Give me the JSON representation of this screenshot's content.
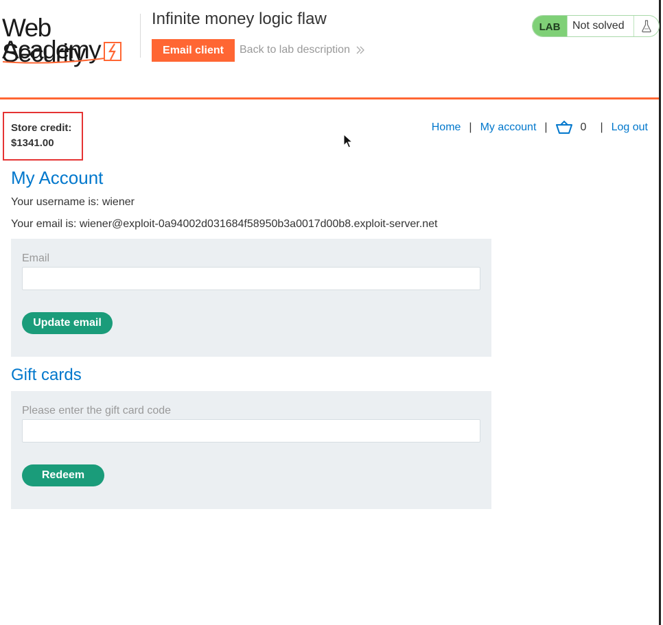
{
  "header": {
    "logo_line1": "Web Security",
    "logo_line2": "Academy",
    "lab_title": "Infinite money logic flaw",
    "email_client_label": "Email client",
    "back_link_label": "Back to lab description",
    "lab_badge": "LAB",
    "lab_status": "Not solved"
  },
  "store_credit": {
    "label": "Store credit:",
    "value": "$1341.00"
  },
  "nav": {
    "home": "Home",
    "my_account": "My account",
    "cart_count": "0",
    "log_out": "Log out",
    "separator": "|"
  },
  "account": {
    "title": "My Account",
    "username_line": "Your username is: wiener",
    "email_line": "Your email is: wiener@exploit-0a94002d031684f58950b3a0017d00b8.exploit-server.net",
    "email_field_label": "Email",
    "email_field_value": "",
    "update_button": "Update email"
  },
  "gift_cards": {
    "title": "Gift cards",
    "field_label": "Please enter the gift card code",
    "field_value": "",
    "redeem_button": "Redeem"
  },
  "colors": {
    "accent_orange": "#ff6633",
    "link_blue": "#0077cc",
    "button_green": "#1a9c7a",
    "lab_green": "#7fd077",
    "highlight_red": "#e53333"
  }
}
